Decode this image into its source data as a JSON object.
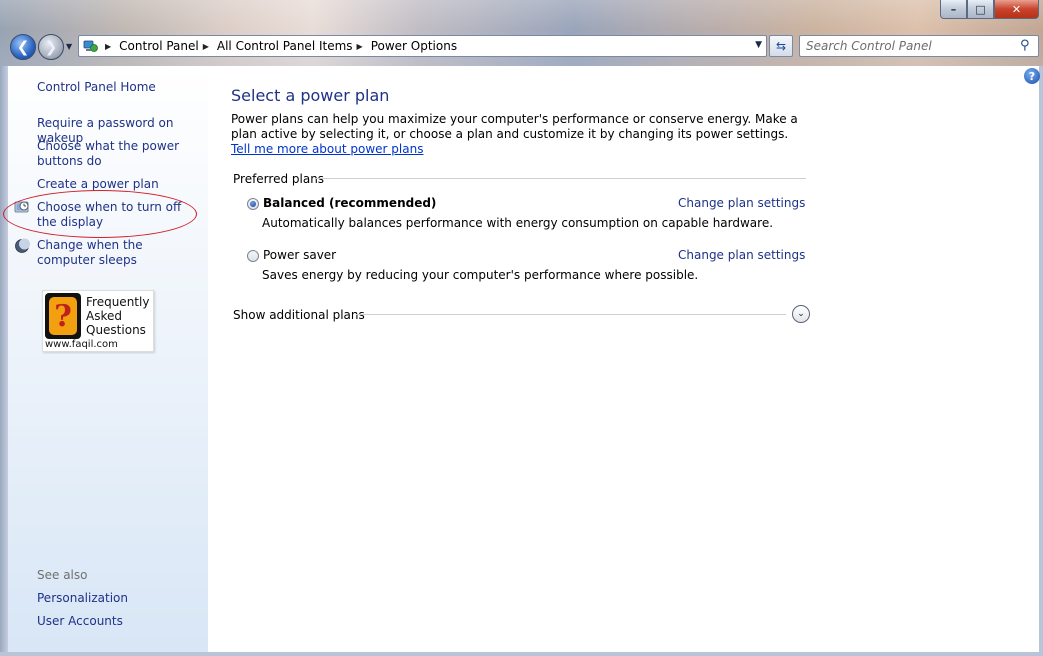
{
  "window": {
    "minimize_label": "–",
    "maximize_label": "□",
    "close_label": "✕"
  },
  "nav": {
    "back_icon": "back-arrow-icon",
    "forward_icon": "forward-arrow-icon",
    "breadcrumbs": [
      "Control Panel",
      "All Control Panel Items",
      "Power Options"
    ],
    "search_placeholder": "Search Control Panel"
  },
  "sidebar": {
    "home": "Control Panel Home",
    "items": [
      {
        "label": "Require a password on wakeup"
      },
      {
        "label": "Choose what the power buttons do"
      },
      {
        "label": "Create a power plan"
      },
      {
        "label": "Choose when to turn off the display",
        "icon": "monitor-clock-icon"
      },
      {
        "label": "Change when the computer sleeps",
        "icon": "moon-icon"
      }
    ],
    "faq": {
      "glyph": "?",
      "line1": "Frequently",
      "line2": "Asked",
      "line3": "Questions",
      "url": "www.faqil.com"
    },
    "see_also": "See also",
    "see_also_items": [
      "Personalization",
      "User Accounts"
    ]
  },
  "main": {
    "help_glyph": "?",
    "title": "Select a power plan",
    "intro": "Power plans can help you maximize your computer's performance or conserve energy. Make a plan active by selecting it, or choose a plan and customize it by changing its power settings.",
    "intro_link": "Tell me more about power plans",
    "preferred_label": "Preferred plans",
    "plans": [
      {
        "name": "Balanced (recommended)",
        "description": "Automatically balances performance with energy consumption on capable hardware.",
        "selected": true,
        "change_link": "Change plan settings"
      },
      {
        "name": "Power saver",
        "description": "Saves energy by reducing your computer's performance where possible.",
        "selected": false,
        "change_link": "Change plan settings"
      }
    ],
    "show_additional": "Show additional plans"
  },
  "colors": {
    "link": "#1e3287",
    "hyperlink": "#0033cc",
    "annotation": "#d0202a"
  }
}
